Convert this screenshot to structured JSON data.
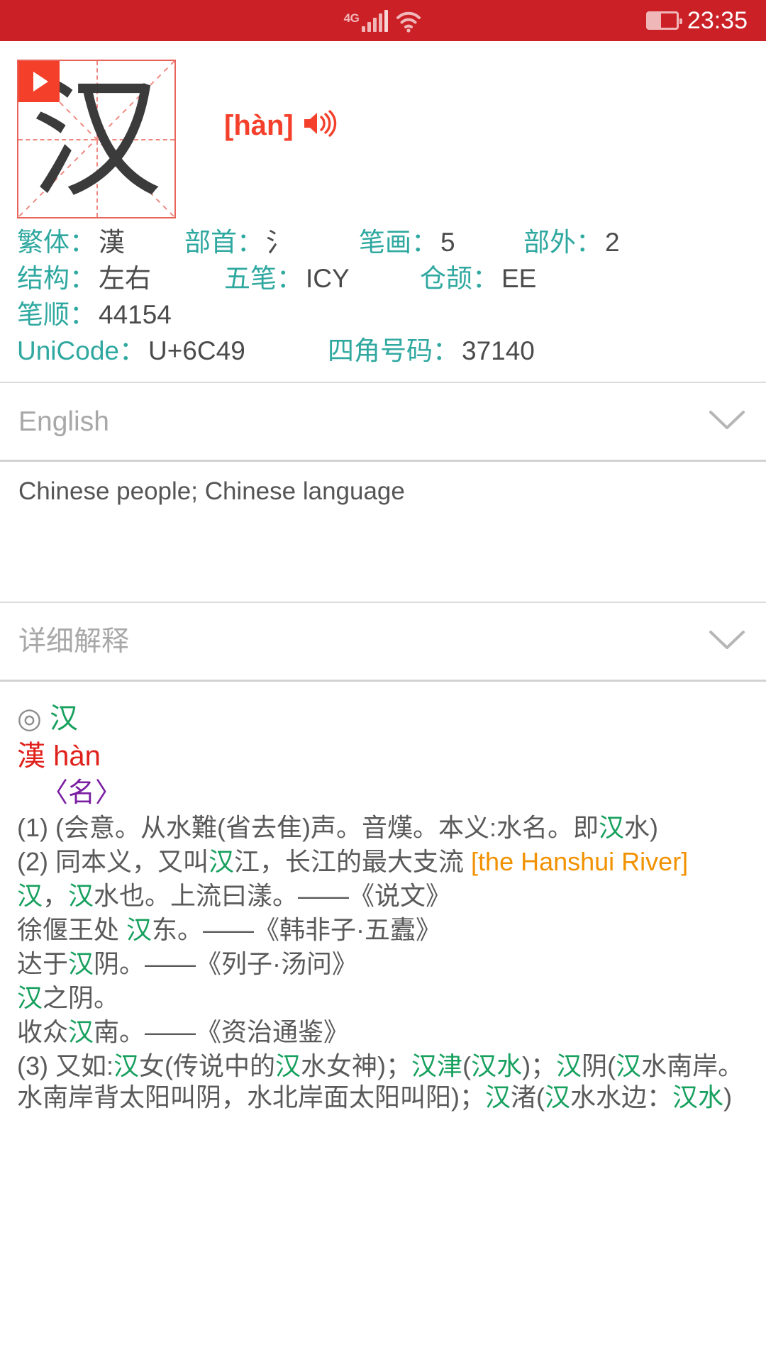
{
  "statusbar": {
    "network_label": "4G",
    "time": "23:35",
    "icons": [
      "signal-icon",
      "wifi-icon",
      "battery-icon"
    ]
  },
  "character": {
    "glyph": "汉",
    "pinyin": "[hàn]",
    "play_label": "play",
    "speaker_label": "pronounce"
  },
  "info": {
    "row1": [
      {
        "label": "繁体：",
        "value": "漢"
      },
      {
        "label": "部首：",
        "value": "氵"
      },
      {
        "label": "笔画：",
        "value": "5"
      },
      {
        "label": "部外：",
        "value": "2"
      }
    ],
    "row2": [
      {
        "label": "结构：",
        "value": "左右"
      },
      {
        "label": "五笔：",
        "value": "ICY"
      },
      {
        "label": "仓颉：",
        "value": "EE"
      }
    ],
    "row3": [
      {
        "label": "笔顺：",
        "value": "44154"
      }
    ],
    "row4": [
      {
        "label": "UniCode：",
        "value": "U+6C49"
      },
      {
        "label": "四角号码：",
        "value": "37140"
      }
    ]
  },
  "sections": {
    "english": {
      "title": "English",
      "chevron": "chevron-down-icon",
      "content": "Chinese people; Chinese language"
    },
    "detail": {
      "title": "详细解释",
      "chevron": "chevron-down-icon"
    }
  },
  "detail_content": {
    "mark": "◎",
    "headword": "汉",
    "traditional": "漢",
    "pinyin": "hàn",
    "pos": "〈名〉",
    "item1_a": "(1) (会意。从水難(省去隹)声。音熯。本义:水名。即",
    "item1_b": "汉",
    "item1_c": "水)",
    "item2_a": "(2) 同本义，又叫",
    "item2_b": "汉",
    "item2_c": "江，长江的最大支流 ",
    "item2_en": "[the Hanshui River]",
    "quote1_a": "汉",
    "quote1_b": "，",
    "quote1_c": "汉",
    "quote1_d": "水也。上流曰漾。——《说文》",
    "quote2_a": "徐偃王处 ",
    "quote2_b": "汉",
    "quote2_c": "东。——《韩非子·五蠹》",
    "quote3_a": "达于",
    "quote3_b": "汉",
    "quote3_c": "阴。——《列子·汤问》",
    "quote4_a": "汉",
    "quote4_b": "之阴。",
    "quote5_a": "收众",
    "quote5_b": "汉",
    "quote5_c": "南。——《资治通鉴》",
    "item3_p1": "(3) 又如:",
    "item3_g1": "汉",
    "item3_p2": "女(传说中的",
    "item3_g2": "汉",
    "item3_p3": "水女神)；",
    "item3_g3": "汉津",
    "item3_p4": "(",
    "item3_g4": "汉水",
    "item3_p5": ")；",
    "item3_g5": "汉",
    "item3_p6": "阴",
    "item3_p7": "(",
    "item3_g6": "汉",
    "item3_p8": "水南岸。水南岸背太阳叫阴，水北岸面太阳叫阳)；",
    "item3_g7": "汉",
    "item3_p9": "渚(",
    "item3_g8": "汉",
    "item3_p10": "水水边：",
    "item3_g9": "汉水",
    "item3_p11": ")"
  },
  "colors": {
    "statusbar_bg": "#CB2026",
    "accent_red": "#F4402B",
    "label_teal": "#2FA8A0",
    "green": "#17A05E",
    "orange": "#F29100",
    "purple": "#7A1FA2",
    "deep_red": "#E0201B"
  }
}
